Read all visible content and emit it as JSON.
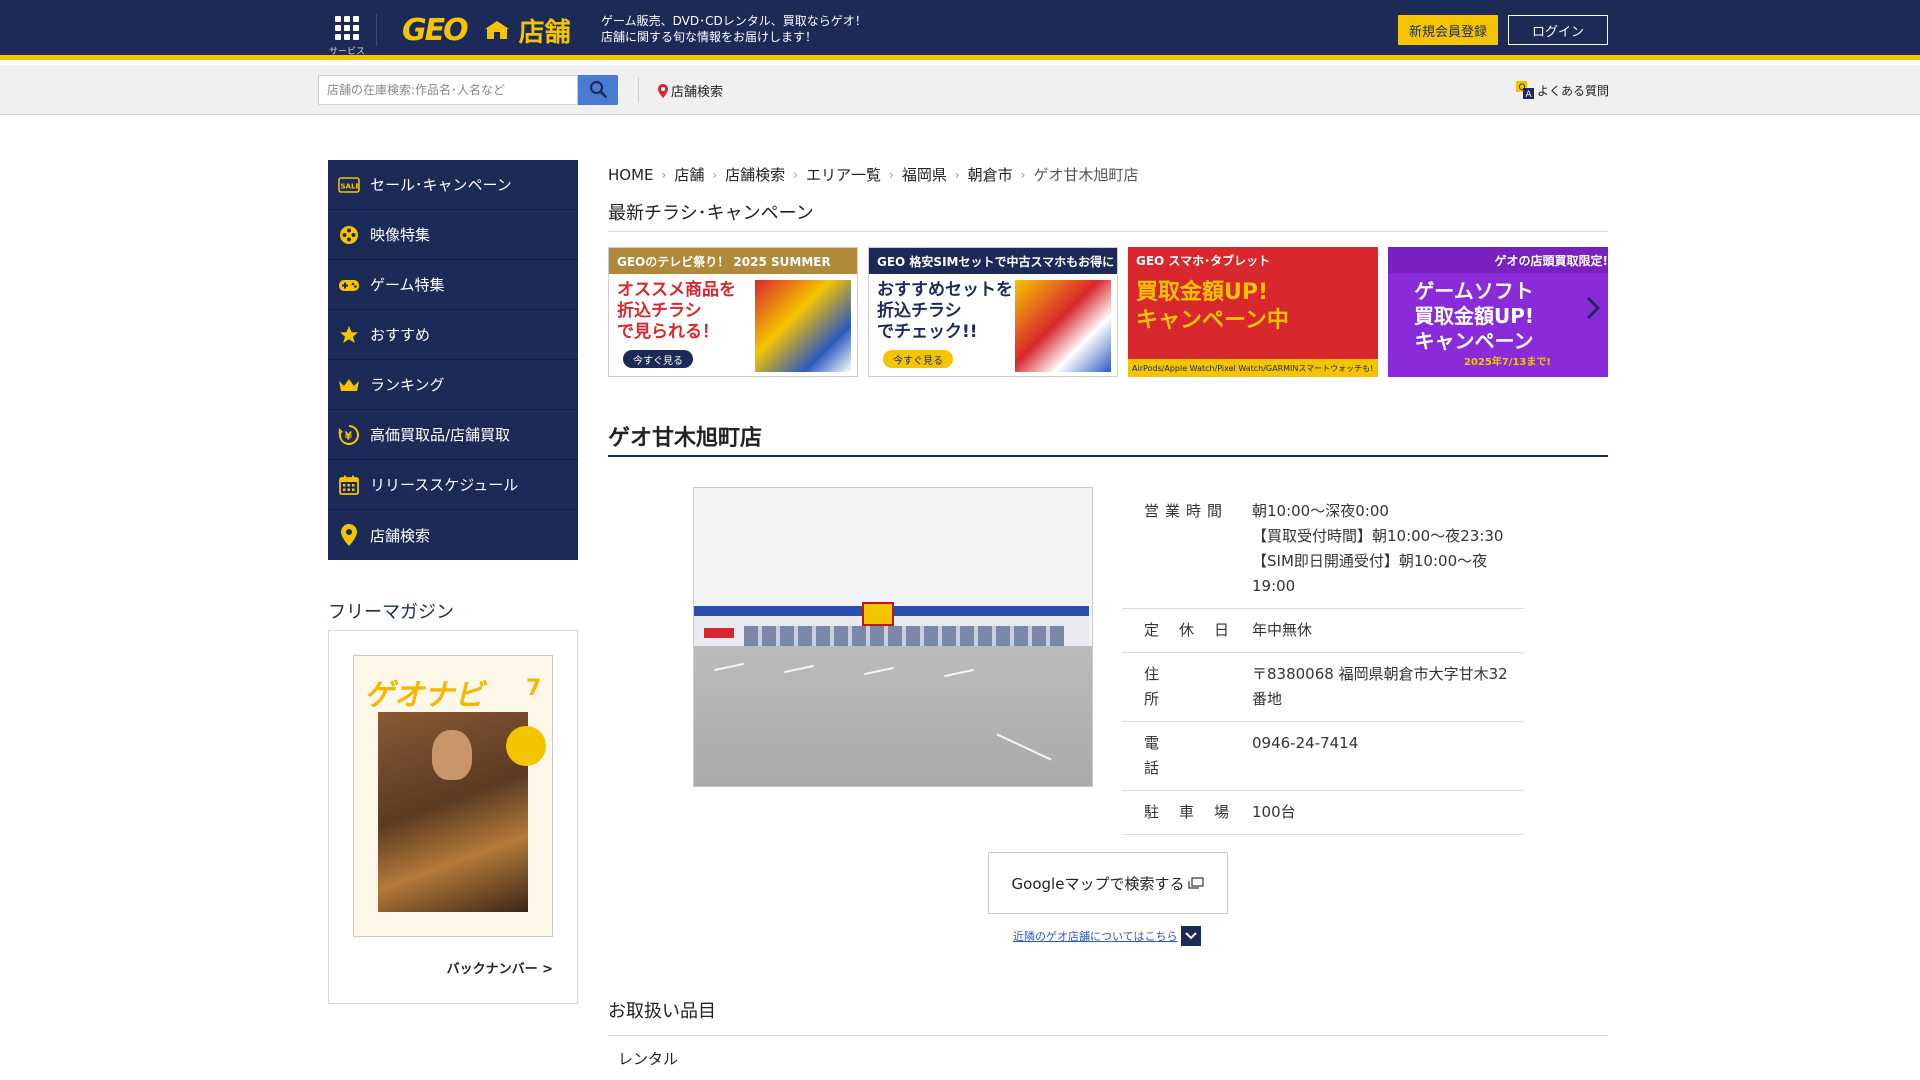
{
  "header": {
    "service_label": "サービス",
    "logo_text": "GEO",
    "tenpo_label": "店舗",
    "tagline_1": "ゲーム販売、DVD･CDレンタル、買取ならゲオ！",
    "tagline_2": "店舗に関する旬な情報をお届けします！",
    "register_label": "新規会員登録",
    "login_label": "ログイン"
  },
  "search": {
    "placeholder": "店舗の在庫検索:作品名･人名など",
    "store_search_label": "店舗検索",
    "faq_label": "よくある質問"
  },
  "sidebar": {
    "items": [
      {
        "label": "セール･キャンペーン",
        "icon": "sale-icon"
      },
      {
        "label": "映像特集",
        "icon": "video-icon"
      },
      {
        "label": "ゲーム特集",
        "icon": "gamepad-icon"
      },
      {
        "label": "おすすめ",
        "icon": "star-icon"
      },
      {
        "label": "ランキング",
        "icon": "crown-icon"
      },
      {
        "label": "高価買取品/店舗買取",
        "icon": "yen-exchange-icon"
      },
      {
        "label": "リリーススケジュール",
        "icon": "calendar-icon"
      },
      {
        "label": "店舗検索",
        "icon": "location-pin-icon"
      }
    ],
    "magazine_title": "フリーマガジン",
    "magazine_cover_title": "ゲオナビ",
    "magazine_issue": "7",
    "backnumber_label": "バックナンバー >"
  },
  "breadcrumb": [
    "HOME",
    "店舗",
    "店舗検索",
    "エリア一覧",
    "福岡県",
    "朝倉市",
    "ゲオ甘木旭町店"
  ],
  "flyer_section_title": "最新チラシ･キャンペーン",
  "banners": [
    {
      "top": "GEOのテレビ祭り！ 2025 SUMMER",
      "main": "オススメ商品を\n折込チラシ\nで見られる！",
      "cta": "今すぐ見る",
      "bg": "#ffffff",
      "topbg": "#b08a3a",
      "color": "#d9272e"
    },
    {
      "top": "GEO 格安SIMセットで中古スマホもお得に",
      "main": "おすすめセットを\n折込チラシ\nでチェック!!",
      "cta": "今すぐ見る",
      "bg": "#ffffff",
      "topbg": "#1b2a57",
      "color": "#1b2a57"
    },
    {
      "top": "GEO スマホ･タブレット",
      "main": "買取金額UP!\nキャンペーン中",
      "cta": "AirPods/Apple Watch/Pixel Watch/GARMINスマートウォッチも!",
      "bg": "#d9272e",
      "topbg": "#d9272e",
      "color": "#f5c400"
    },
    {
      "top": "ゲオの店頭買取限定!",
      "main": "ゲームソフト\n買取金額UP!\nキャンペーン",
      "cta": "2025年7/13まで!",
      "bg": "#8a2bd9",
      "topbg": "#7a1fc0",
      "color": "#ffffff"
    }
  ],
  "store": {
    "name": "ゲオ甘木旭町店",
    "info": [
      {
        "key": "営業時間",
        "value": "朝10:00〜深夜0:00\n【買取受付時間】朝10:00〜夜23:30\n【SIM即日開通受付】朝10:00〜夜19:00"
      },
      {
        "key": "定休日",
        "value": "年中無休"
      },
      {
        "key": "住所",
        "value": "〒8380068 福岡県朝倉市大字甘木32番地"
      },
      {
        "key": "電話",
        "value": "0946-24-7414"
      },
      {
        "key": "駐車場",
        "value": "100台"
      }
    ],
    "gmap_label": "Googleマップで検索する",
    "nearby_label": "近隣のゲオ店舗についてはこちら"
  },
  "items_section_title": "お取扱い品目",
  "items": [
    "レンタル"
  ],
  "colors": {
    "navy": "#1b2a57",
    "yellow": "#f5c400",
    "link": "#2a5bbf"
  }
}
